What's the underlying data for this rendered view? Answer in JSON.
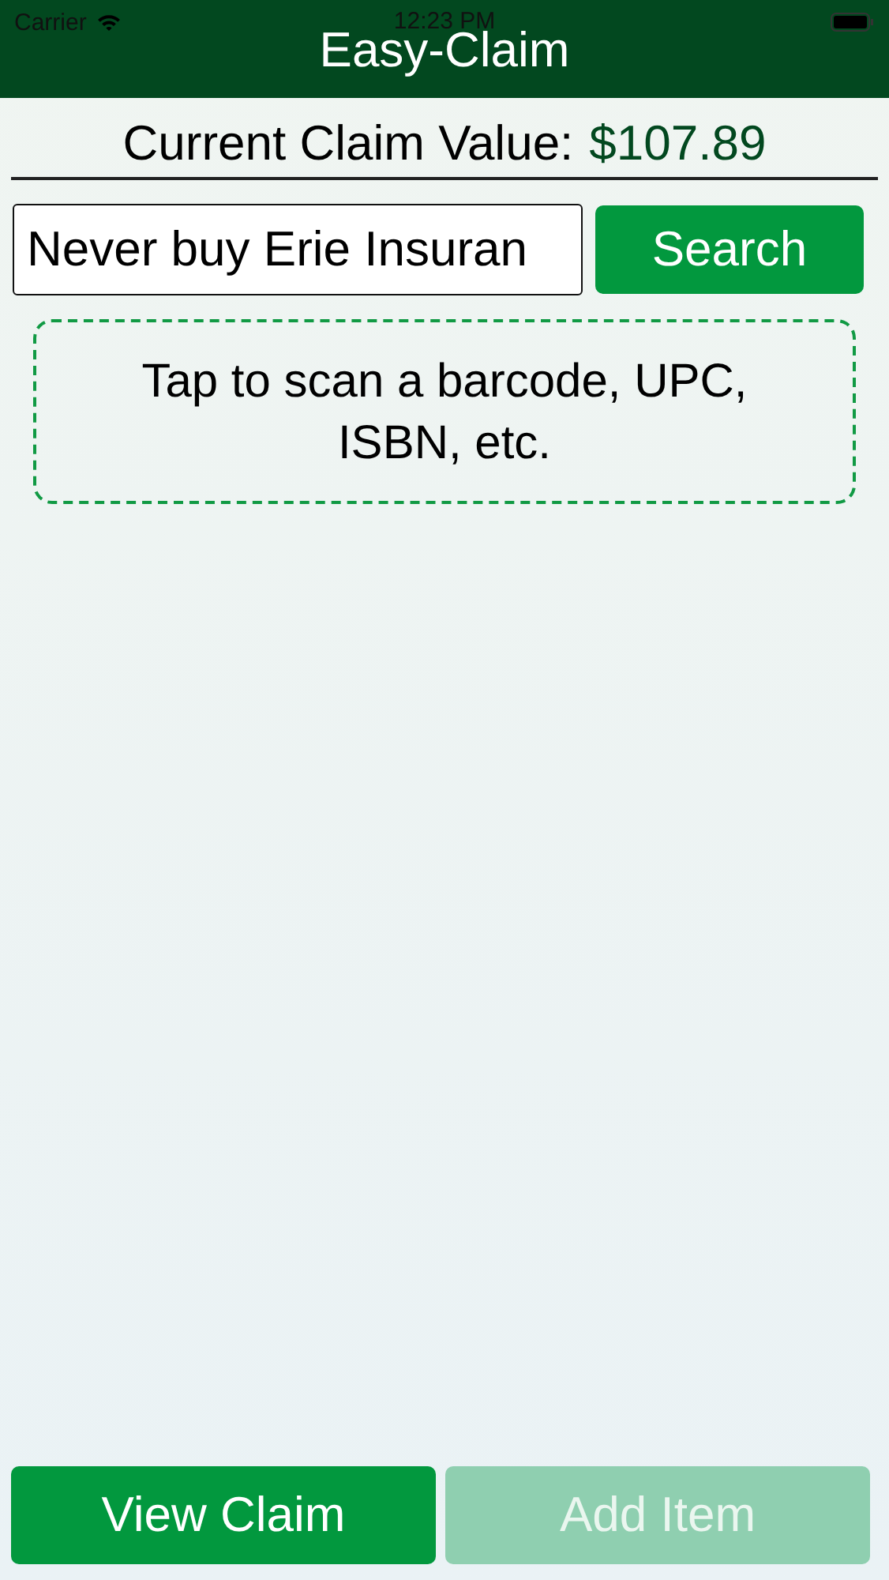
{
  "status_bar": {
    "carrier": "Carrier",
    "time": "12:23 PM"
  },
  "nav": {
    "title": "Easy-Claim"
  },
  "claim": {
    "label": "Current Claim Value:",
    "value": "$107.89"
  },
  "search": {
    "value": "Never buy Erie Insuran",
    "button": "Search"
  },
  "scan_prompt": "Tap to scan a barcode, UPC, ISBN, etc.",
  "buttons": [
    {
      "label": "View Claim",
      "disabled": false
    },
    {
      "label": "Add Item",
      "disabled": true
    }
  ]
}
